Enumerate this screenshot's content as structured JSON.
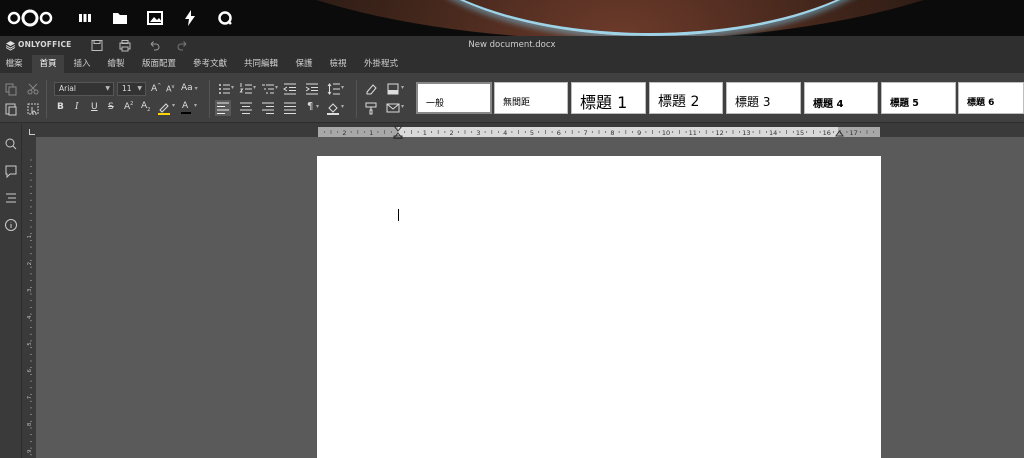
{
  "nextcloud": {
    "icons": [
      "nextcloud-logo",
      "dashboard-icon",
      "files-icon",
      "photos-icon",
      "activity-icon",
      "search-icon"
    ]
  },
  "onlyoffice": {
    "logo_text": "ONLYOFFICE",
    "document_title": "New document.docx"
  },
  "tabs": [
    {
      "label": "檔案"
    },
    {
      "label": "首頁"
    },
    {
      "label": "插入"
    },
    {
      "label": "繪製"
    },
    {
      "label": "版面配置"
    },
    {
      "label": "參考文獻"
    },
    {
      "label": "共同編輯"
    },
    {
      "label": "保護"
    },
    {
      "label": "檢視"
    },
    {
      "label": "外掛程式"
    }
  ],
  "active_tab": "首頁",
  "toolbar": {
    "font_name": "Arial",
    "font_size": "11",
    "case_label": "Aa",
    "grow_font": "A",
    "shrink_font": "A",
    "bold": "B",
    "italic": "I",
    "underline": "U",
    "strike": "S",
    "superscript": "A",
    "subscript": "A",
    "font_color": "A"
  },
  "styles": [
    {
      "label": "一般"
    },
    {
      "label": "無間距"
    },
    {
      "label": "標題 1"
    },
    {
      "label": "標題 2"
    },
    {
      "label": "標題 3"
    },
    {
      "label": "標題 4"
    },
    {
      "label": "標題 5"
    },
    {
      "label": "標題 6"
    }
  ],
  "ruler": {
    "h_labels": [
      "2",
      "1",
      "1",
      "2",
      "3",
      "4",
      "5",
      "6",
      "7",
      "8",
      "9",
      "10",
      "11",
      "12",
      "13",
      "14",
      "15",
      "16",
      "17"
    ],
    "v_labels": [
      "1",
      "2",
      "3",
      "4",
      "5",
      "6",
      "7",
      "8",
      "9"
    ]
  },
  "colors": {
    "accent_highlight": "#ffd400",
    "font_color_bar": "#000000",
    "toolbar_bg": "#404040",
    "canvas_bg": "#5a5a5a"
  }
}
